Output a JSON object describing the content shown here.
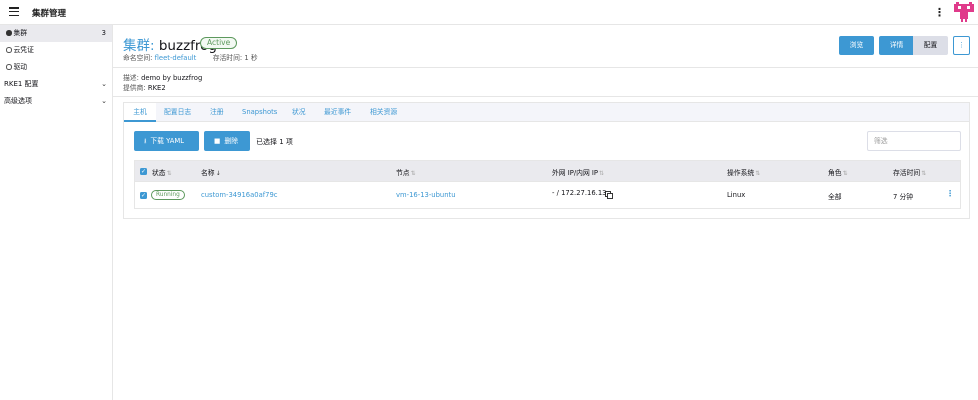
{
  "header": {
    "title": "集群管理"
  },
  "sidebar": {
    "items": [
      {
        "label": "集群",
        "count": "3"
      },
      {
        "label": "云凭证"
      },
      {
        "label": "驱动"
      }
    ],
    "groups": [
      {
        "label": "RKE1 配置"
      },
      {
        "label": "高级选项"
      }
    ]
  },
  "cluster": {
    "title_prefix": "集群:",
    "name": "buzzfrog",
    "status": "Active",
    "namespace_label": "命名空间:",
    "namespace_value": "fleet-default",
    "age_label": "存活时间:",
    "age_value": "1 秒",
    "description_label": "描述:",
    "description_value": "demo by buzzfrog",
    "provider_label": "提供商:",
    "provider_value": "RKE2"
  },
  "actions": {
    "browse": "浏览",
    "details": "详情",
    "config": "配置",
    "more": "⋮"
  },
  "tabs": [
    {
      "label": "主机"
    },
    {
      "label": "配置日志"
    },
    {
      "label": "注册"
    },
    {
      "label": "Snapshots"
    },
    {
      "label": "状况"
    },
    {
      "label": "最近事件"
    },
    {
      "label": "相关资源"
    }
  ],
  "toolbar": {
    "download_yaml": "下载 YAML",
    "delete": "删除",
    "selected_text": "已选择 1 项",
    "filter_placeholder": "筛选"
  },
  "table": {
    "columns": [
      "状态",
      "名称",
      "节点",
      "外网 IP/内网 IP",
      "操作系统",
      "角色",
      "存活时间"
    ],
    "rows": [
      {
        "state": "Running",
        "name": "custom-34916a0af79c",
        "node": "vm-16-13-ubuntu",
        "ip": "- / 172.27.16.13",
        "os": "Linux",
        "role": "全部",
        "age": "7 分钟"
      }
    ]
  },
  "colors": {
    "primary": "#3d98d3",
    "success": "#5d995d",
    "logo": "#e03b8b"
  }
}
